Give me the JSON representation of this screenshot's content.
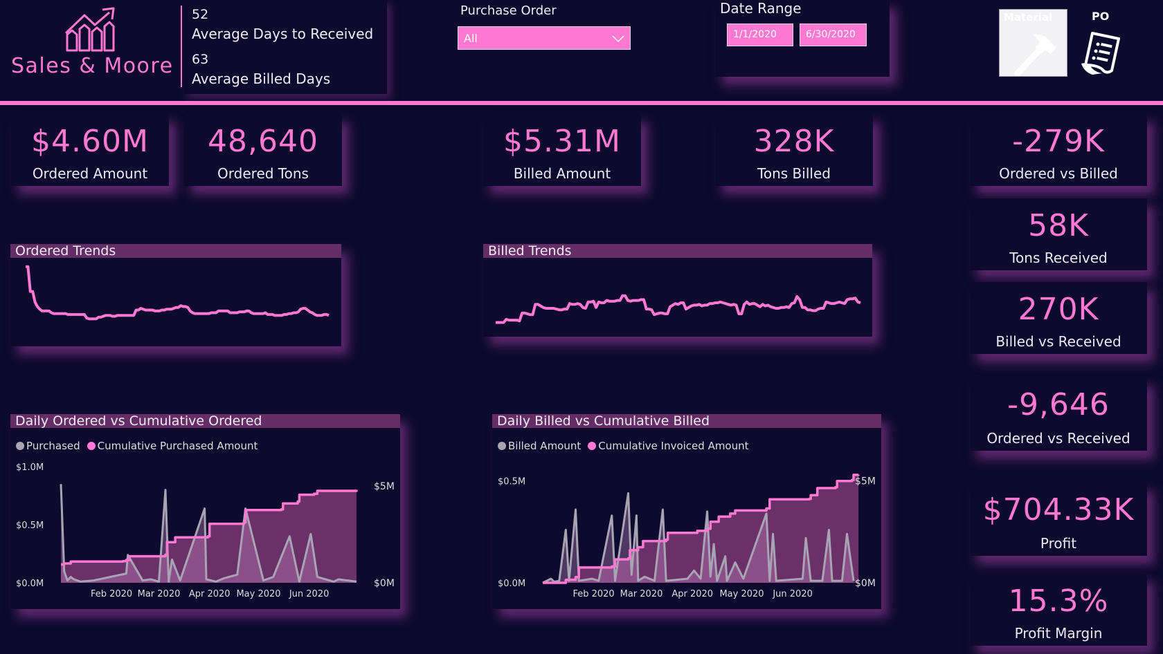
{
  "brand": {
    "name": "Sales & Moore",
    "logo_icon": "chart-growth-icon"
  },
  "header_stats": [
    {
      "value": "52",
      "label": "Average Days to Received"
    },
    {
      "value": "63",
      "label": "Average Billed Days"
    }
  ],
  "filters": {
    "purchase_order": {
      "label": "Purchase Order",
      "selected": "All"
    },
    "date_range": {
      "label": "Date Range",
      "start": "1/1/2020",
      "end": "6/30/2020"
    }
  },
  "nav_buttons": {
    "material": {
      "label": "Material",
      "icon": "hammer-icon"
    },
    "po": {
      "label": "PO",
      "icon": "document-list-icon"
    }
  },
  "colors": {
    "background": "#0e0a2e",
    "accent": "#ff78d2",
    "panel_title": "#652d65",
    "gray_series": "#a8a4b4"
  },
  "kpis": {
    "ordered_amount": {
      "value": "$4.60M",
      "label": "Ordered Amount"
    },
    "ordered_tons": {
      "value": "48,640",
      "label": "Ordered Tons"
    },
    "billed_amount": {
      "value": "$5.31M",
      "label": "Billed Amount"
    },
    "tons_billed": {
      "value": "328K",
      "label": "Tons Billed"
    },
    "ordered_vs_billed": {
      "value": "-279K",
      "label": "Ordered vs Billed"
    },
    "tons_received": {
      "value": "58K",
      "label": "Tons Received"
    },
    "billed_vs_received": {
      "value": "270K",
      "label": "Billed vs Received"
    },
    "ordered_vs_received": {
      "value": "-9,646",
      "label": "Ordered vs Received"
    },
    "profit": {
      "value": "$704.33K",
      "label": "Profit"
    },
    "profit_margin": {
      "value": "15.3%",
      "label": "Profit Margin"
    }
  },
  "chart_data": [
    {
      "id": "ordered_trends",
      "type": "line",
      "title": "Ordered Trends",
      "values": [
        90,
        90,
        62,
        62,
        50,
        45,
        42,
        40,
        40,
        40,
        40,
        38,
        37,
        37,
        37,
        37,
        37,
        37,
        36,
        36,
        36,
        36,
        36,
        36,
        36,
        36,
        32,
        31,
        31,
        31,
        31,
        33,
        33,
        34,
        35,
        35,
        35,
        34,
        34,
        35,
        35,
        35,
        35,
        35,
        35,
        35,
        35,
        41,
        41,
        43,
        42,
        41,
        41,
        41,
        41,
        40,
        40,
        40,
        41,
        41,
        42,
        42,
        42,
        43,
        44,
        44,
        46,
        45,
        45,
        44,
        40,
        38,
        37,
        37,
        37,
        37,
        37,
        37,
        37,
        38,
        38,
        38,
        40,
        40,
        40,
        40,
        40,
        38,
        38,
        38,
        38,
        39,
        39,
        39,
        40,
        40,
        38,
        37,
        37,
        37,
        37,
        37,
        38,
        36,
        36,
        36,
        35,
        35,
        35,
        35,
        36,
        36,
        37,
        37,
        38,
        38,
        39,
        42,
        43,
        43,
        41,
        39,
        38,
        36,
        35,
        35,
        35,
        36,
        36,
        35
      ]
    },
    {
      "id": "billed_trends",
      "type": "line",
      "title": "Billed Trends",
      "values": [
        18,
        18,
        18,
        18,
        22,
        21,
        21,
        21,
        21,
        20,
        30,
        30,
        29,
        28,
        28,
        41,
        41,
        39,
        37,
        36,
        36,
        36,
        36,
        35,
        34,
        34,
        35,
        35,
        42,
        41,
        41,
        42,
        41,
        37,
        36,
        44,
        44,
        45,
        37,
        44,
        43,
        43,
        46,
        45,
        45,
        45,
        46,
        46,
        52,
        52,
        46,
        45,
        46,
        46,
        46,
        47,
        47,
        35,
        35,
        34,
        28,
        29,
        30,
        30,
        29,
        29,
        38,
        40,
        42,
        41,
        43,
        43,
        35,
        37,
        39,
        40,
        40,
        41,
        39,
        40,
        40,
        42,
        42,
        43,
        43,
        44,
        43,
        42,
        41,
        40,
        41,
        40,
        29,
        29,
        41,
        44,
        41,
        42,
        42,
        40,
        38,
        41,
        39,
        40,
        38,
        37,
        36,
        36,
        37,
        37,
        38,
        37,
        42,
        43,
        51,
        47,
        37,
        37,
        34,
        34,
        33,
        33,
        35,
        36,
        36,
        44,
        43,
        42,
        42,
        43,
        44,
        43,
        42,
        47,
        48,
        48,
        49,
        44,
        43
      ]
    },
    {
      "id": "daily_ordered",
      "type": "area",
      "title": "Daily Ordered vs Cumulative Ordered",
      "legend": [
        "Purchased",
        "Cumulative Purchased Amount"
      ],
      "x_ticks": [
        "Feb 2020",
        "Mar 2020",
        "Apr 2020",
        "May 2020",
        "Jun 2020"
      ],
      "y_left": {
        "ticks": [
          "$0.0M",
          "$0.5M",
          "$1.0M"
        ],
        "range": [
          0,
          1.0
        ]
      },
      "y_right": {
        "ticks": [
          "$0M",
          "$5M"
        ],
        "range": [
          0,
          6
        ]
      },
      "x_range_days": [
        0,
        181
      ],
      "daily_series": [
        [
          0,
          0.85
        ],
        [
          2,
          0.1
        ],
        [
          4,
          0.02
        ],
        [
          6,
          0.05
        ],
        [
          8,
          0.03
        ],
        [
          12,
          0.01
        ],
        [
          20,
          0.02
        ],
        [
          30,
          0.05
        ],
        [
          40,
          0.08
        ],
        [
          41,
          0.24
        ],
        [
          50,
          0.02
        ],
        [
          55,
          0.03
        ],
        [
          60,
          0.01
        ],
        [
          64,
          0.8
        ],
        [
          66,
          0.01
        ],
        [
          68,
          0.2
        ],
        [
          73,
          0.02
        ],
        [
          88,
          0.64
        ],
        [
          89,
          0.03
        ],
        [
          95,
          0.01
        ],
        [
          100,
          0.04
        ],
        [
          108,
          0.07
        ],
        [
          113,
          0.64
        ],
        [
          124,
          0.02
        ],
        [
          130,
          0.05
        ],
        [
          140,
          0.4
        ],
        [
          146,
          0.01
        ],
        [
          153,
          0.42
        ],
        [
          157,
          0.05
        ],
        [
          167,
          0.01
        ],
        [
          170,
          0.03
        ],
        [
          181,
          0.01
        ]
      ],
      "cumulative_series": [
        [
          0,
          0.95
        ],
        [
          2,
          1.0
        ],
        [
          6,
          1.1
        ],
        [
          38,
          1.12
        ],
        [
          40,
          1.18
        ],
        [
          42,
          1.37
        ],
        [
          64,
          1.45
        ],
        [
          65,
          2.1
        ],
        [
          70,
          2.35
        ],
        [
          90,
          2.4
        ],
        [
          91,
          3.05
        ],
        [
          112,
          3.12
        ],
        [
          113,
          3.76
        ],
        [
          135,
          3.8
        ],
        [
          136,
          4.1
        ],
        [
          145,
          4.2
        ],
        [
          146,
          4.55
        ],
        [
          155,
          4.6
        ],
        [
          157,
          4.75
        ],
        [
          181,
          4.8
        ]
      ]
    },
    {
      "id": "daily_billed",
      "type": "area",
      "title": "Daily Billed vs Cumulative Billed",
      "legend": [
        "Billed Amount",
        "Cumulative Invoiced Amount"
      ],
      "x_ticks": [
        "Feb 2020",
        "Mar 2020",
        "Apr 2020",
        "May 2020",
        "Jun 2020"
      ],
      "y_left": {
        "ticks": [
          "$0.0M",
          "$0.5M"
        ],
        "range": [
          0,
          0.55
        ]
      },
      "y_right": {
        "ticks": [
          "$0M",
          "$5M"
        ],
        "range": [
          0,
          5.5
        ]
      },
      "x_range_days": [
        0,
        181
      ],
      "daily_series": [
        [
          0,
          0
        ],
        [
          5,
          0.02
        ],
        [
          7,
          0.005
        ],
        [
          10,
          0.01
        ],
        [
          14,
          0.26
        ],
        [
          16,
          0.01
        ],
        [
          20,
          0.36
        ],
        [
          22,
          0.01
        ],
        [
          30,
          0.02
        ],
        [
          34,
          0.01
        ],
        [
          42,
          0.33
        ],
        [
          44,
          0.01
        ],
        [
          52,
          0.44
        ],
        [
          54,
          0.04
        ],
        [
          57,
          0.33
        ],
        [
          58,
          0.01
        ],
        [
          62,
          0.03
        ],
        [
          68,
          0.01
        ],
        [
          73,
          0.36
        ],
        [
          75,
          0.01
        ],
        [
          88,
          0.02
        ],
        [
          92,
          0.06
        ],
        [
          96,
          0.02
        ],
        [
          100,
          0.35
        ],
        [
          102,
          0.03
        ],
        [
          104,
          0.19
        ],
        [
          106,
          0.01
        ],
        [
          111,
          0.13
        ],
        [
          112,
          0.01
        ],
        [
          116,
          0.08
        ],
        [
          117,
          0.1
        ],
        [
          122,
          0.02
        ],
        [
          136,
          0.34
        ],
        [
          138,
          0.01
        ],
        [
          140,
          0.24
        ],
        [
          142,
          0.01
        ],
        [
          158,
          0.02
        ],
        [
          160,
          0.22
        ],
        [
          163,
          0.01
        ],
        [
          170,
          0.01
        ],
        [
          174,
          0.26
        ],
        [
          176,
          0.01
        ],
        [
          182,
          0.01
        ],
        [
          185,
          0.24
        ],
        [
          189,
          0.01
        ]
      ],
      "cumulative_series": [
        [
          0,
          0
        ],
        [
          8,
          0
        ],
        [
          14,
          0.15
        ],
        [
          20,
          0.28
        ],
        [
          22,
          0.75
        ],
        [
          42,
          0.8
        ],
        [
          44,
          1.15
        ],
        [
          52,
          1.2
        ],
        [
          53,
          1.6
        ],
        [
          58,
          1.75
        ],
        [
          61,
          2.05
        ],
        [
          75,
          2.12
        ],
        [
          76,
          2.45
        ],
        [
          94,
          2.55
        ],
        [
          100,
          2.65
        ],
        [
          102,
          3.0
        ],
        [
          107,
          3.25
        ],
        [
          114,
          3.4
        ],
        [
          117,
          3.55
        ],
        [
          136,
          3.65
        ],
        [
          138,
          4.1
        ],
        [
          162,
          4.12
        ],
        [
          163,
          4.3
        ],
        [
          167,
          4.65
        ],
        [
          178,
          4.7
        ],
        [
          179,
          5.0
        ],
        [
          188,
          5.05
        ],
        [
          189,
          5.3
        ],
        [
          192,
          5.31
        ]
      ]
    }
  ]
}
